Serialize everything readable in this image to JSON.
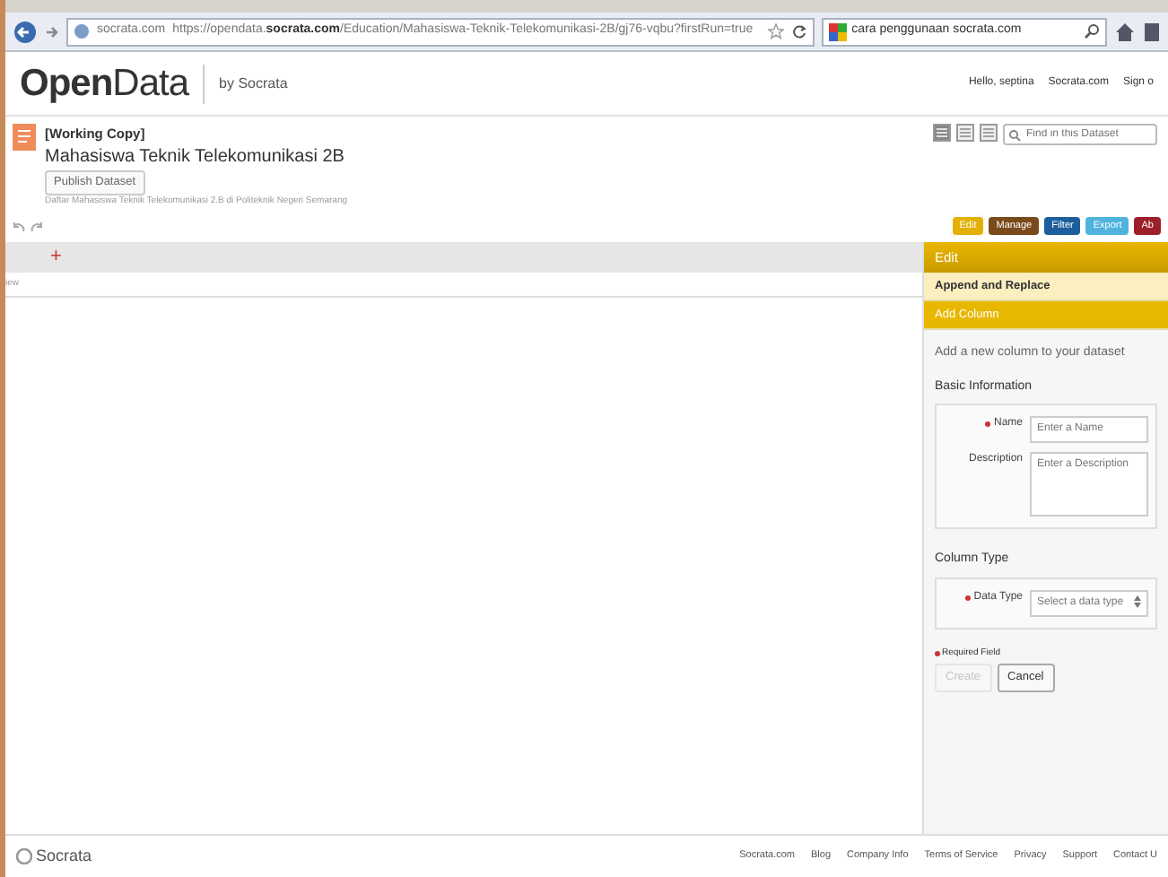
{
  "browser": {
    "site": "socrata.com",
    "url_pre": "https://opendata.",
    "url_host": "socrata.com",
    "url_post": "/Education/Mahasiswa-Teknik-Telekomunikasi-2B/gj76-vqbu?firstRun=true",
    "search": "cara penggunaan socrata.com"
  },
  "header": {
    "logo_open": "Open",
    "logo_data": "Data",
    "by": "by Socrata",
    "links": [
      "Hello, septina",
      "Socrata.com",
      "Sign o"
    ]
  },
  "dataset": {
    "badge": "[Working Copy]",
    "title": "Mahasiswa Teknik Telekomunikasi 2B",
    "publish": "Publish Dataset",
    "description": "Daftar Mahasiswa Teknik Telekomunikasi 2.B di Politeknik Negeri Semarang",
    "find_placeholder": "Find in this Dataset"
  },
  "view_modes": [
    {
      "selected": true
    },
    {
      "selected": false
    },
    {
      "selected": false
    }
  ],
  "actions": [
    {
      "label": "Edit",
      "color": "#e2b007",
      "selected": true
    },
    {
      "label": "Manage",
      "color": "#7a4a1c",
      "selected": false
    },
    {
      "label": "Filter",
      "color": "#1d5f9c",
      "selected": false
    },
    {
      "label": "Export",
      "color": "#4fb3dd",
      "selected": false
    },
    {
      "label": "Ab",
      "color": "#9c1f2a",
      "selected": false
    }
  ],
  "grid": {
    "add": "+",
    "row_label": "iew"
  },
  "panel": {
    "title": "Edit",
    "sections": [
      {
        "label": "Append and Replace",
        "selected": false
      },
      {
        "label": "Add Column",
        "selected": true
      }
    ],
    "intro": "Add a new column to your dataset",
    "basic": "Basic Information",
    "name_label": "Name",
    "name_placeholder": "Enter a Name",
    "desc_label": "Description",
    "desc_placeholder": "Enter a Description",
    "type_heading": "Column Type",
    "type_label": "Data Type",
    "type_value": "Select a data type",
    "required": "Required Field",
    "create": "Create",
    "cancel": "Cancel"
  },
  "footer": {
    "brand": "Socrata",
    "links": [
      "Socrata.com",
      "Blog",
      "Company Info",
      "Terms of Service",
      "Privacy",
      "Support",
      "Contact U"
    ]
  }
}
